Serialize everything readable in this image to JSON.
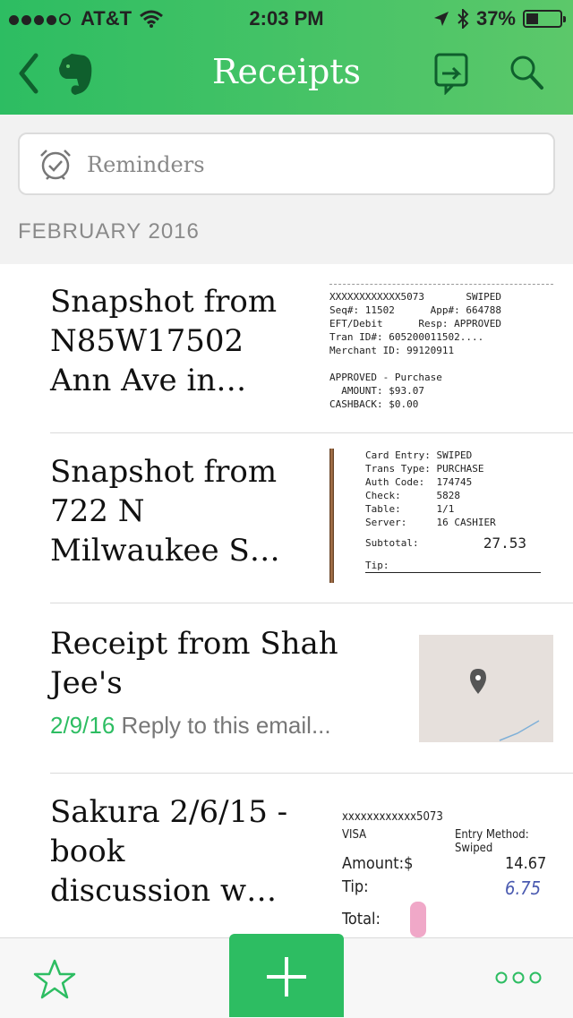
{
  "status": {
    "carrier": "AT&T",
    "time": "2:03 PM",
    "battery": "37%",
    "battery_level": 0.37
  },
  "header": {
    "title": "Receipts"
  },
  "reminders": {
    "label": "Reminders"
  },
  "section": {
    "label": "FEBRUARY 2016"
  },
  "notes": [
    {
      "title": "Snapshot from N85W17502 Ann Ave in…",
      "thumb_lines": [
        "XXXXXXXXXXXX5073       SWIPED",
        "Seq#: 11502      App#: 664788",
        "EFT/Debit      Resp: APPROVED",
        "Tran ID#: 605200011502....",
        "Merchant ID: 99120911",
        "",
        "APPROVED - Purchase",
        "  AMOUNT: $93.07",
        "CASHBACK: $0.00"
      ]
    },
    {
      "title": "Snapshot from 722 N Milwaukee S…",
      "thumb_lines": [
        "Card Entry: SWIPED",
        "Trans Type: PURCHASE",
        "Auth Code:  174745",
        "Check:      5828",
        "Table:      1/1",
        "Server:     16 CASHIER"
      ],
      "subtotal_label": "Subtotal:",
      "subtotal_value": "27.53",
      "tip_label": "Tip:"
    },
    {
      "title": "Receipt from Shah Jee's",
      "date": "2/9/16",
      "snippet": "Reply to this email..."
    },
    {
      "title": "Sakura 2/6/15 - book discussion w…",
      "thumb_card": "xxxxxxxxxxxx5073",
      "thumb_type": "VISA",
      "thumb_entry": "Entry Method: Swiped",
      "thumb_amount_label": "Amount:$",
      "thumb_amount": "14.67",
      "thumb_tip_label": "Tip:",
      "thumb_tip": "6.75",
      "thumb_total_label": "Total:"
    }
  ],
  "colors": {
    "accent": "#2dbd62",
    "header_end": "#5cc86a"
  }
}
